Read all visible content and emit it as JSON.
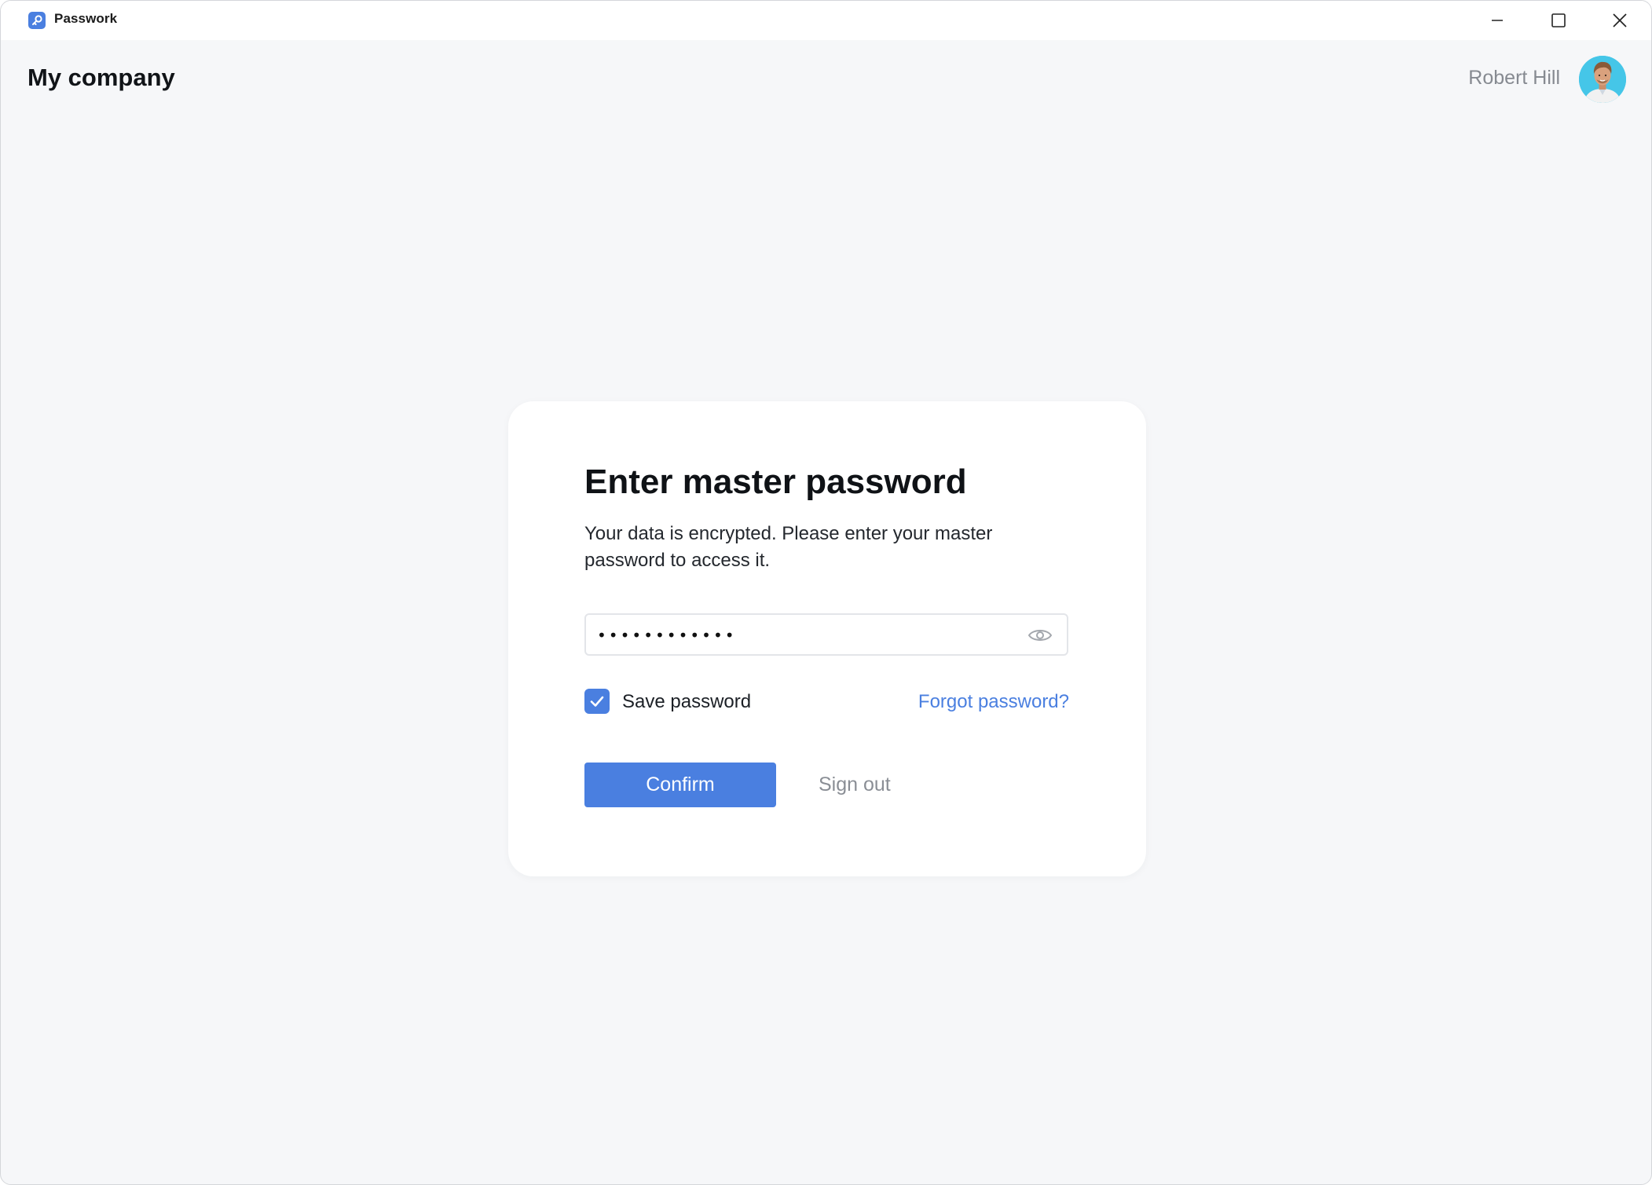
{
  "window": {
    "app_name": "Passwork",
    "accent_color": "#4a7fe0",
    "controls": [
      "minimize-icon",
      "maximize-icon",
      "close-icon"
    ]
  },
  "header": {
    "company": "My company",
    "user_name": "Robert Hill",
    "avatar_color": "#45c6e8"
  },
  "dialog": {
    "title": "Enter master password",
    "description": "Your data is encrypted. Please enter your master password to access it.",
    "password_value": "••••••••••••",
    "show_password_icon": "eye-icon",
    "save_password_label": "Save password",
    "save_password_checked": true,
    "forgot_label": "Forgot password?",
    "confirm_label": "Confirm",
    "signout_label": "Sign out"
  }
}
